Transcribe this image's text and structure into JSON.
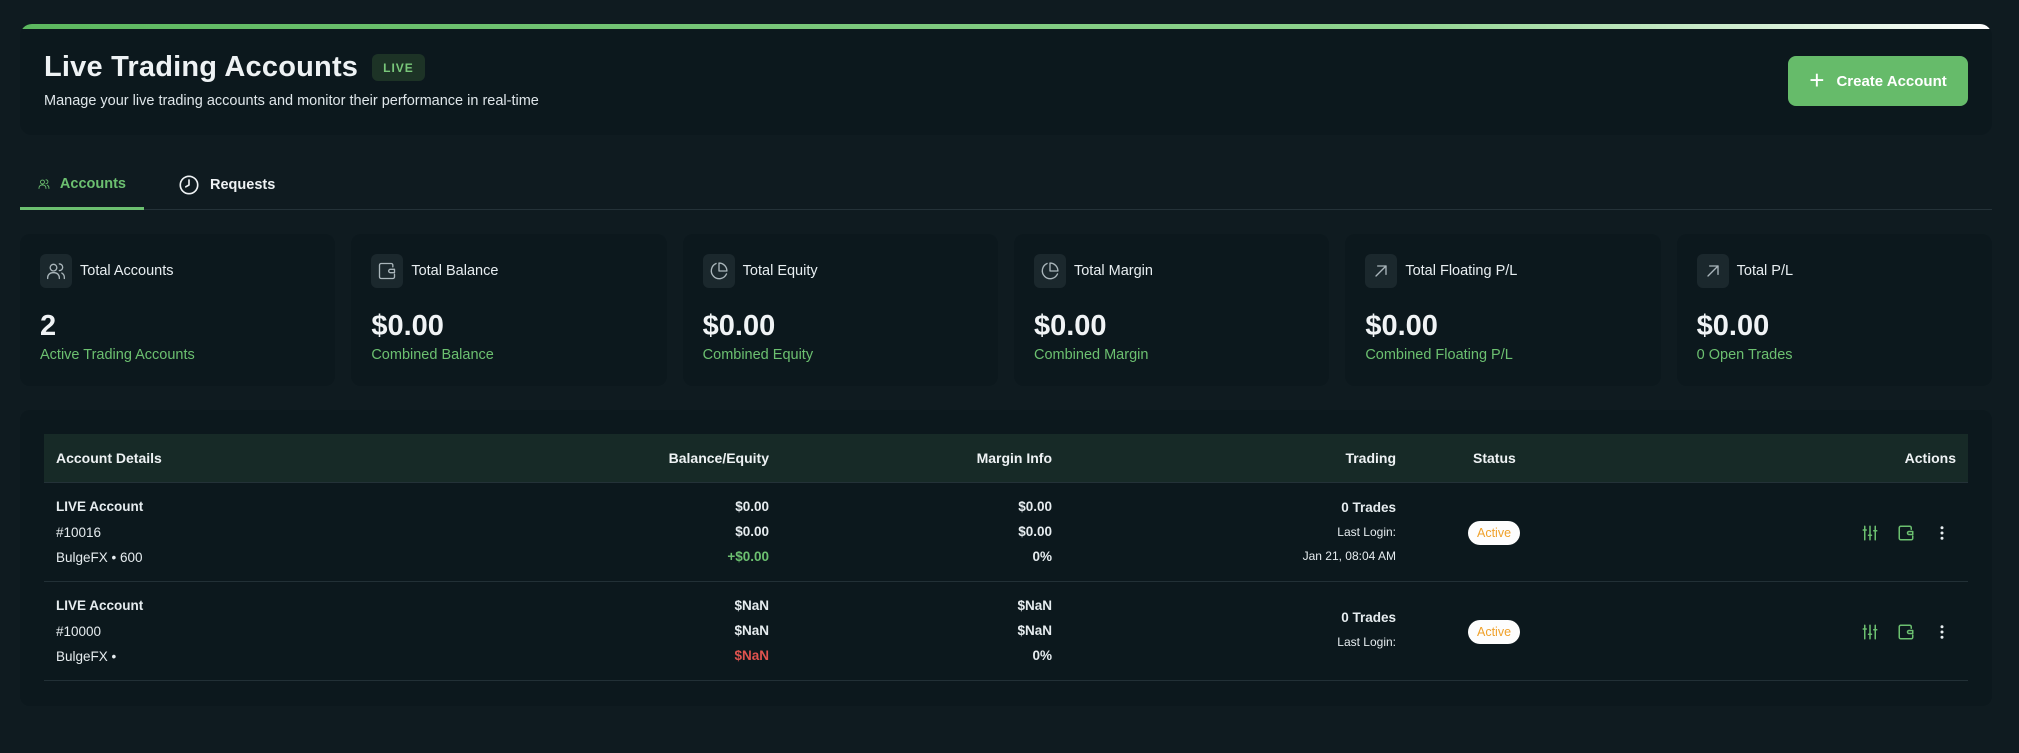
{
  "header": {
    "title": "Live Trading Accounts",
    "badge": "LIVE",
    "subtitle": "Manage your live trading accounts and monitor their performance in real-time",
    "create_button": "Create Account"
  },
  "tabs": [
    {
      "label": "Accounts",
      "icon": "users-icon",
      "active": true
    },
    {
      "label": "Requests",
      "icon": "clock-icon",
      "active": false
    }
  ],
  "stats": [
    {
      "label": "Total Accounts",
      "value": "2",
      "desc": "Active Trading Accounts",
      "icon": "users-icon"
    },
    {
      "label": "Total Balance",
      "value": "$0.00",
      "desc": "Combined Balance",
      "icon": "wallet-icon"
    },
    {
      "label": "Total Equity",
      "value": "$0.00",
      "desc": "Combined Equity",
      "icon": "pie-chart-icon"
    },
    {
      "label": "Total Margin",
      "value": "$0.00",
      "desc": "Combined Margin",
      "icon": "pie-chart-icon"
    },
    {
      "label": "Total Floating P/L",
      "value": "$0.00",
      "desc": "Combined Floating P/L",
      "icon": "arrow-up-right-icon"
    },
    {
      "label": "Total P/L",
      "value": "$0.00",
      "desc": "0 Open Trades",
      "icon": "arrow-up-right-icon"
    }
  ],
  "table": {
    "headers": {
      "details": "Account Details",
      "balance": "Balance/Equity",
      "margin": "Margin Info",
      "trading": "Trading",
      "status": "Status",
      "actions": "Actions"
    },
    "rows": [
      {
        "name": "LIVE Account",
        "number": "#10016",
        "broker": "BulgeFX • 600",
        "balance": "$0.00",
        "equity": "$0.00",
        "pl": "+$0.00",
        "margin": "$0.00",
        "free_margin": "$0.00",
        "margin_level": "0%",
        "trades": "0 Trades",
        "last_login_label": "Last Login:",
        "last_login": "Jan 21, 08:04 AM",
        "status": "Active"
      },
      {
        "name": "LIVE Account",
        "number": "#10000",
        "broker": "BulgeFX •",
        "balance": "$NaN",
        "equity": "$NaN",
        "pl": "$NaN",
        "margin": "$NaN",
        "free_margin": "$NaN",
        "margin_level": "0%",
        "trades": "0 Trades",
        "last_login_label": "Last Login:",
        "last_login": "",
        "status": "Active"
      }
    ]
  },
  "colors": {
    "accent": "#66bb6a",
    "background": "#0f1b20",
    "card": "#0c181d",
    "negative": "#e0534f",
    "status_active": "#f0a12a"
  }
}
